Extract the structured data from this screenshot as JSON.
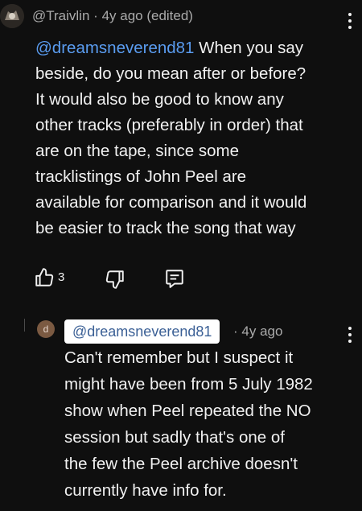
{
  "comment": {
    "author": "@Traivlin",
    "separator": "·",
    "time": "4y ago (edited)",
    "mention": "@dreamsneverend81",
    "first_line_rest": "When you say",
    "lines": [
      "beside, do you mean after or before?",
      "It would also be good to know any",
      "other tracks (preferably in order) that",
      "are on the tape, since some",
      "tracklistings of John Peel are",
      "available for comparison and it would",
      "be easier to track the song that way"
    ],
    "like_count": "3"
  },
  "reply": {
    "avatar_letter": "d",
    "mention": "@dreamsneverend81",
    "separator": "·",
    "time": "4y ago",
    "lines": [
      "Can't remember but I suspect it",
      "might have been from 5 July 1982",
      "show when Peel repeated the NO",
      "session but sadly that's one of",
      "the few the Peel archive doesn't",
      "currently have info for."
    ]
  },
  "icons": {
    "like": "thumbs-up-icon",
    "dislike": "thumbs-down-icon",
    "reply": "comment-icon",
    "more": "kebab-menu-icon"
  }
}
